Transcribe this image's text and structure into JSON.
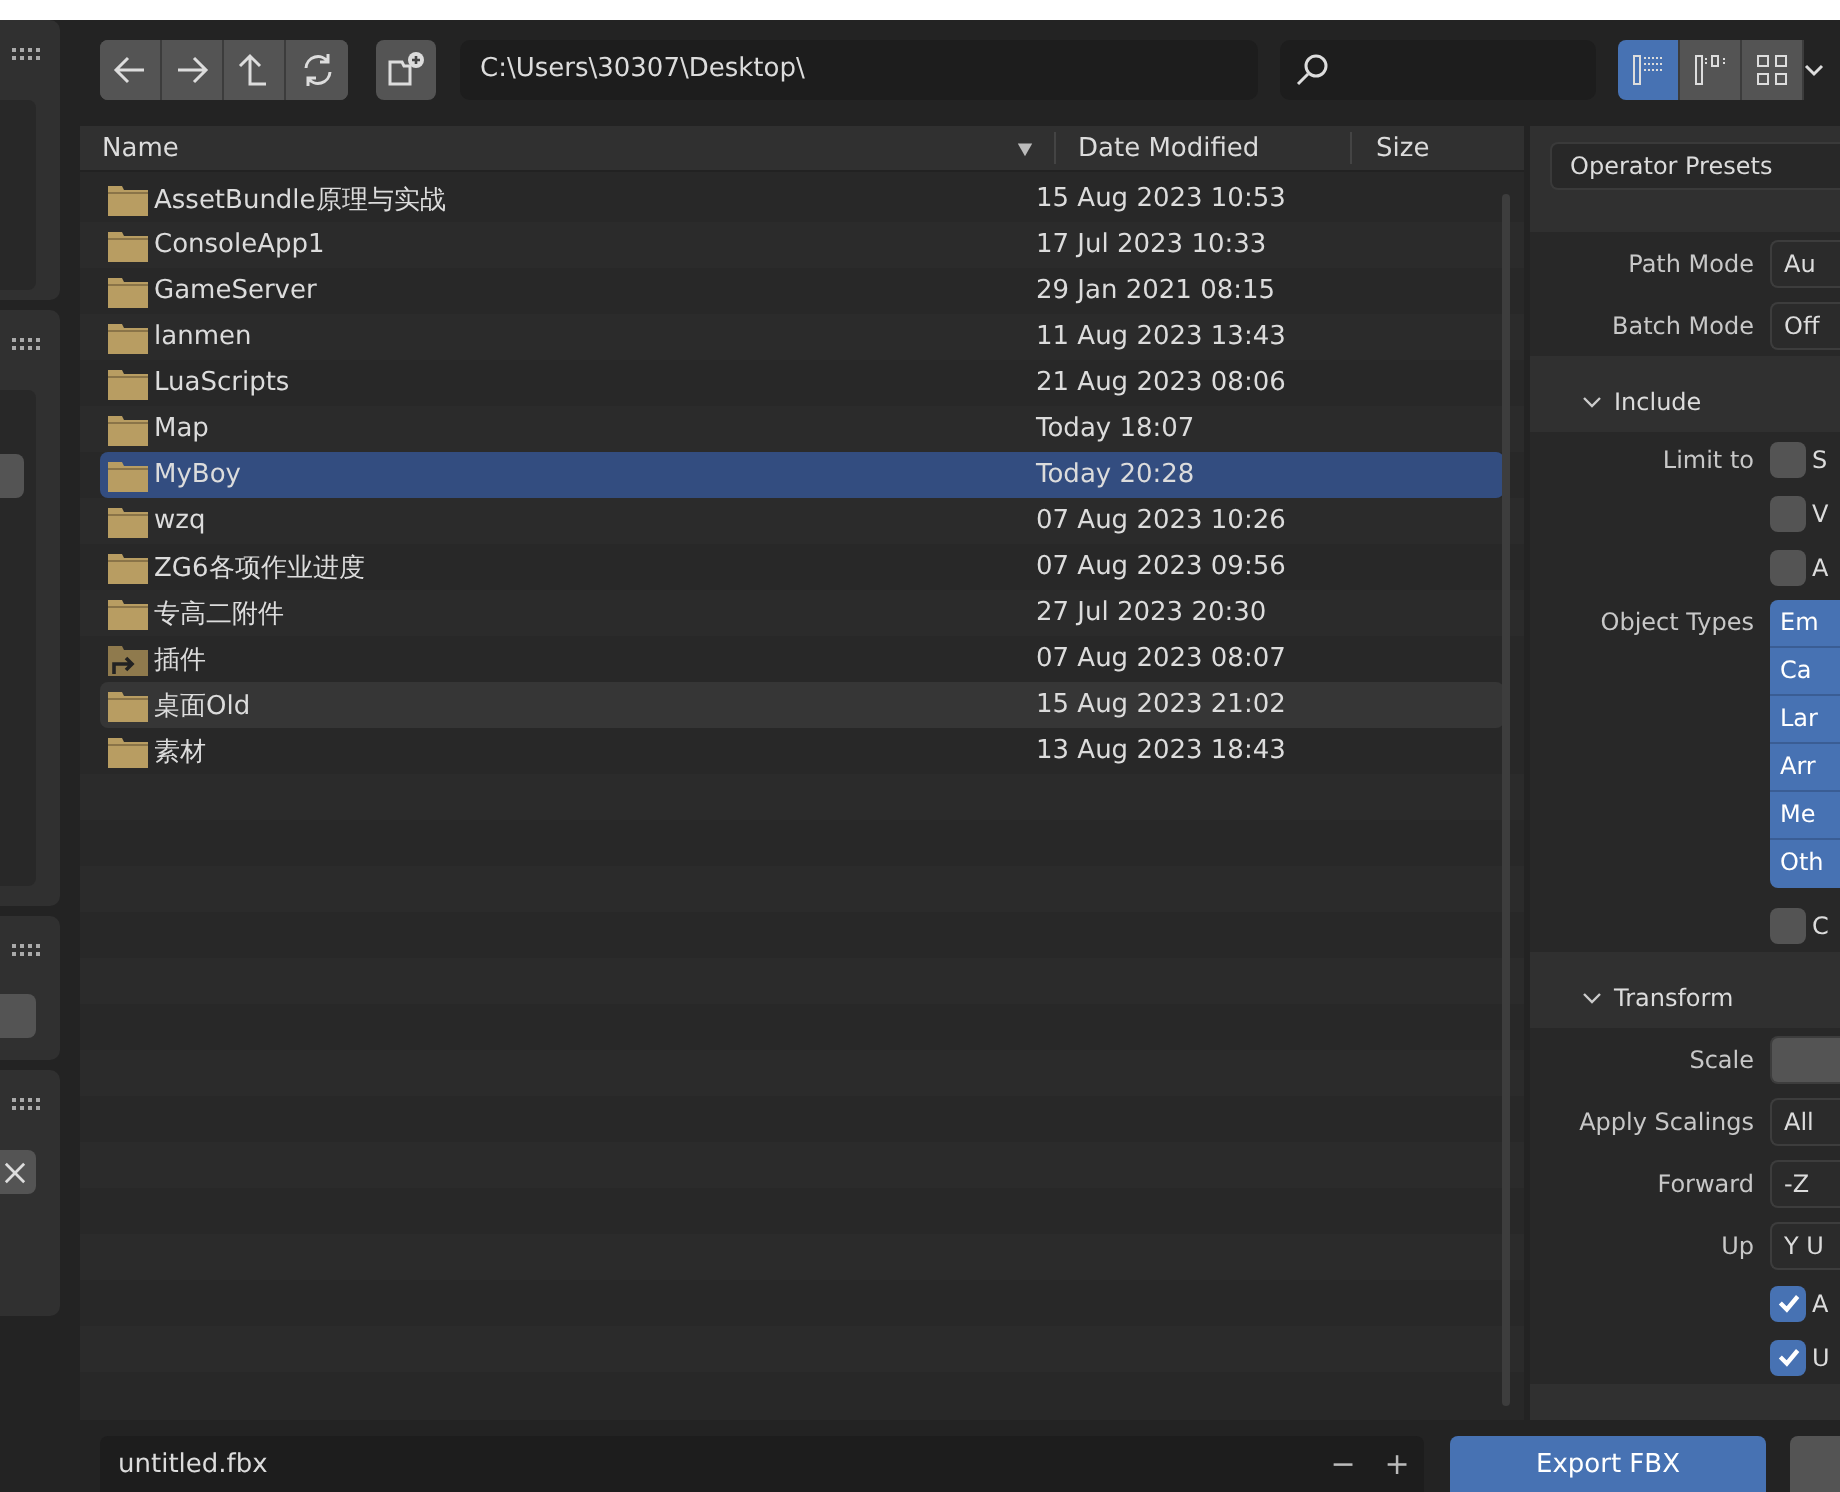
{
  "toolbar": {
    "path": "C:\\Users\\30307\\Desktop\\",
    "view_modes": [
      {
        "selected": true
      },
      {
        "selected": false
      },
      {
        "selected": false
      }
    ]
  },
  "columns": [
    "Name",
    "Date Modified",
    "Size"
  ],
  "files": [
    {
      "name": "AssetBundle原理与实战",
      "date": "15 Aug 2023 10:53",
      "kind": "folder",
      "selected": false,
      "hovered": false
    },
    {
      "name": "ConsoleApp1",
      "date": "17 Jul 2023 10:33",
      "kind": "folder",
      "selected": false,
      "hovered": false
    },
    {
      "name": "GameServer",
      "date": "29 Jan 2021 08:15",
      "kind": "folder",
      "selected": false,
      "hovered": false
    },
    {
      "name": "lanmen",
      "date": "11 Aug 2023 13:43",
      "kind": "folder",
      "selected": false,
      "hovered": false
    },
    {
      "name": "LuaScripts",
      "date": "21 Aug 2023 08:06",
      "kind": "folder",
      "selected": false,
      "hovered": false
    },
    {
      "name": "Map",
      "date": "Today 18:07",
      "kind": "folder",
      "selected": false,
      "hovered": false
    },
    {
      "name": "MyBoy",
      "date": "Today 20:28",
      "kind": "folder",
      "selected": true,
      "hovered": false
    },
    {
      "name": "wzq",
      "date": "07 Aug 2023 10:26",
      "kind": "folder",
      "selected": false,
      "hovered": false
    },
    {
      "name": "ZG6各项作业进度",
      "date": "07 Aug 2023 09:56",
      "kind": "folder",
      "selected": false,
      "hovered": false
    },
    {
      "name": "专高二附件",
      "date": "27 Jul 2023 20:30",
      "kind": "folder",
      "selected": false,
      "hovered": false
    },
    {
      "name": "插件",
      "date": "07 Aug 2023 08:07",
      "kind": "link",
      "selected": false,
      "hovered": false
    },
    {
      "name": "桌面Old",
      "date": "15 Aug 2023 21:02",
      "kind": "folder",
      "selected": false,
      "hovered": true
    },
    {
      "name": "素材",
      "date": "13 Aug 2023 18:43",
      "kind": "folder",
      "selected": false,
      "hovered": false
    }
  ],
  "side_panel": {
    "presets": "Operator Presets",
    "items": [
      {
        "kind": "dropdown",
        "label": "Path Mode",
        "value": "Au"
      },
      {
        "kind": "dropdown",
        "label": "Batch Mode",
        "value": "Off"
      },
      {
        "kind": "section",
        "title": "Include",
        "expanded": true
      },
      {
        "kind": "checkbox",
        "label": "Limit to",
        "text": "S",
        "checked": false
      },
      {
        "kind": "checkbox",
        "text": "V",
        "checked": false
      },
      {
        "kind": "checkbox",
        "text": "A",
        "checked": false
      },
      {
        "kind": "toggles",
        "label": "Object Types",
        "options": [
          {
            "text": "Em",
            "selected": true
          },
          {
            "text": "Ca",
            "selected": true
          },
          {
            "text": "Lar",
            "selected": true
          },
          {
            "text": "Arr",
            "selected": true
          },
          {
            "text": "Me",
            "selected": true
          },
          {
            "text": "Oth",
            "selected": true
          }
        ]
      },
      {
        "kind": "checkbox",
        "text": "C",
        "checked": false
      },
      {
        "kind": "section",
        "title": "Transform",
        "expanded": true
      },
      {
        "kind": "field",
        "label": "Scale"
      },
      {
        "kind": "dropdown",
        "label": "Apply Scalings",
        "value": "All"
      },
      {
        "kind": "dropdown",
        "label": "Forward",
        "value": "-Z"
      },
      {
        "kind": "dropdown",
        "label": "Up",
        "value": "Y U"
      },
      {
        "kind": "checkbox",
        "text": "A",
        "checked": true
      },
      {
        "kind": "checkbox",
        "text": "U",
        "checked": true
      }
    ]
  },
  "filename": "untitled.fbx",
  "decrement": "−",
  "increment": "+",
  "export_button": "Export FBX"
}
